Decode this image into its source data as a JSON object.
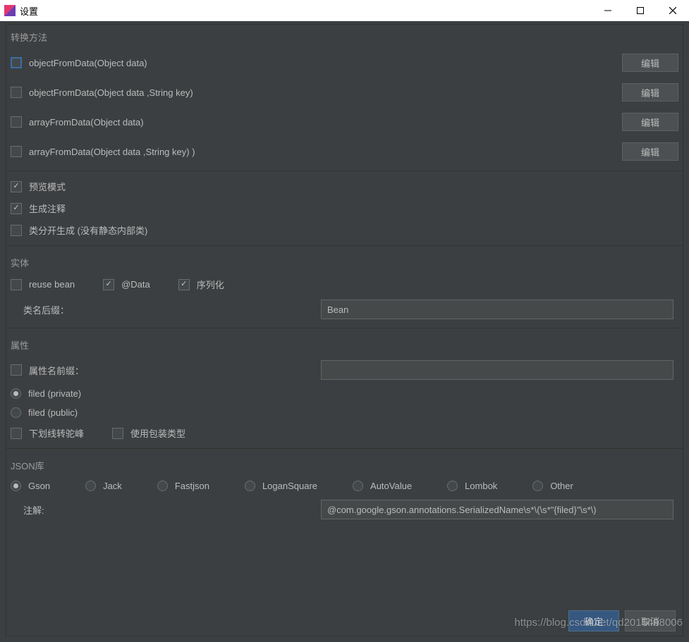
{
  "window": {
    "title": "设置"
  },
  "sections": {
    "convert_method": "转换方法",
    "entity": "实体",
    "property": "属性",
    "json_lib": "JSON库"
  },
  "methods": [
    {
      "label": "objectFromData(Object data)",
      "checked": false,
      "highlight": true,
      "edit": "编辑"
    },
    {
      "label": "objectFromData(Object data ,String key)",
      "checked": false,
      "highlight": false,
      "edit": "编辑"
    },
    {
      "label": "arrayFromData(Object data)",
      "checked": false,
      "highlight": false,
      "edit": "编辑"
    },
    {
      "label": "arrayFromData(Object data ,String key) )",
      "checked": false,
      "highlight": false,
      "edit": "编辑"
    }
  ],
  "options": {
    "preview_mode": {
      "label": "预览模式",
      "checked": true
    },
    "gen_comment": {
      "label": "生成注释",
      "checked": true
    },
    "split_class": {
      "label": "类分开生成  (没有静态内部类)",
      "checked": false
    }
  },
  "entity": {
    "reuse_bean": {
      "label": "reuse bean",
      "checked": false
    },
    "data_anno": {
      "label": "@Data",
      "checked": true
    },
    "serialize": {
      "label": "序列化",
      "checked": true
    },
    "suffix_label": "类名后缀：",
    "suffix_value": "Bean"
  },
  "property": {
    "prefix_check": {
      "label": "属性名前缀：",
      "checked": false
    },
    "prefix_value": "",
    "field_private": {
      "label": "filed (private)",
      "checked": true
    },
    "field_public": {
      "label": "filed (public)",
      "checked": false
    },
    "underscore_camel": {
      "label": "下划线转驼峰",
      "checked": false
    },
    "use_boxed": {
      "label": "使用包装类型",
      "checked": false
    }
  },
  "json": {
    "options": [
      {
        "name": "gson",
        "label": "Gson",
        "checked": true
      },
      {
        "name": "jack",
        "label": "Jack",
        "checked": false
      },
      {
        "name": "fastjson",
        "label": "Fastjson",
        "checked": false
      },
      {
        "name": "logansquare",
        "label": "LoganSquare",
        "checked": false
      },
      {
        "name": "autovalue",
        "label": "AutoValue",
        "checked": false
      },
      {
        "name": "lombok",
        "label": "Lombok",
        "checked": false
      },
      {
        "name": "other",
        "label": "Other",
        "checked": false
      }
    ],
    "annotation_label": "注解:",
    "annotation_value": "@com.google.gson.annotations.SerializedName\\s*\\(\\s*\"{filed}\"\\s*\\)"
  },
  "buttons": {
    "ok": "确定",
    "cancel": "取消"
  },
  "watermark": "https://blog.csdn.net/qd2015498006"
}
